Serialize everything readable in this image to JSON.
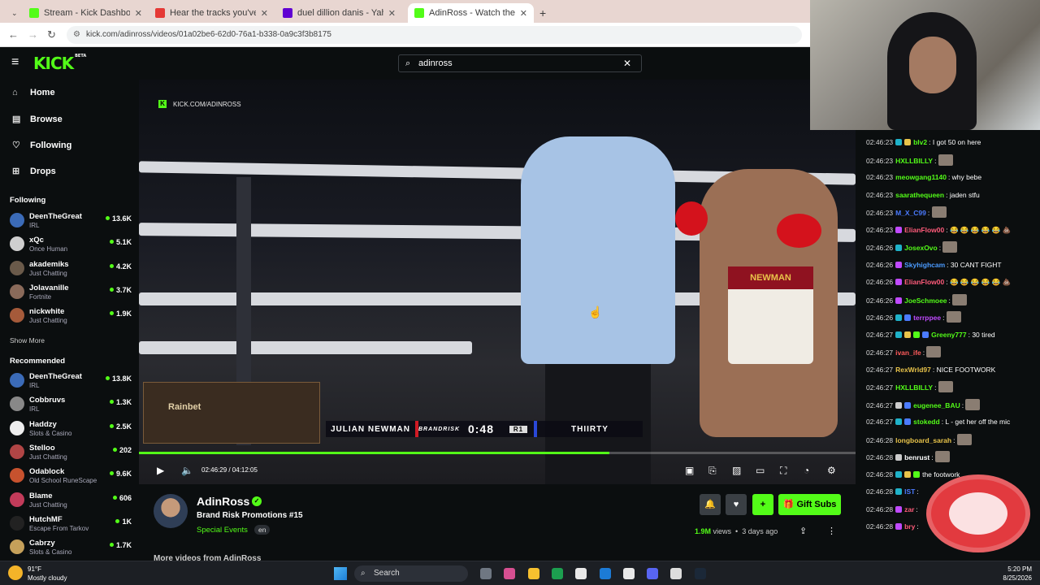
{
  "browser": {
    "tabs": [
      {
        "title": "Stream - Kick Dashboard",
        "favicon_color": "#53fc18",
        "active": false
      },
      {
        "title": "Hear the tracks you've liked: on",
        "favicon_color": "#e53935",
        "active": false
      },
      {
        "title": "duel dillion danis - Yahoo Sear",
        "favicon_color": "#6001d2",
        "active": false
      },
      {
        "title": "AdinRoss - Watch the VOD on",
        "favicon_color": "#53fc18",
        "active": true
      }
    ],
    "new_tab_label": "+",
    "url": "kick.com/adinross/videos/01a02be6-62d0-76a1-b338-0a9c3f3b8175"
  },
  "kick": {
    "logo": "KICK",
    "logo_tag": "BETA",
    "search_value": "adinross",
    "nav": [
      {
        "label": "Home",
        "icon": "home-icon",
        "glyph": "⌂"
      },
      {
        "label": "Browse",
        "icon": "browse-icon",
        "glyph": "▤"
      },
      {
        "label": "Following",
        "icon": "heart-icon",
        "glyph": "♡"
      },
      {
        "label": "Drops",
        "icon": "drops-icon",
        "glyph": "⊞"
      }
    ],
    "following_header": "Following",
    "following": [
      {
        "name": "DeenTheGreat",
        "game": "IRL",
        "viewers": "13.6K",
        "color": "#3b6bb8"
      },
      {
        "name": "xQc",
        "game": "Once Human",
        "viewers": "5.1K",
        "color": "#cfcfcf"
      },
      {
        "name": "akademiks",
        "game": "Just Chatting",
        "viewers": "4.2K",
        "color": "#6a5a4a"
      },
      {
        "name": "Jolavanille",
        "game": "Fortnite",
        "viewers": "3.7K",
        "color": "#8a6a5a"
      },
      {
        "name": "nickwhite",
        "game": "Just Chatting",
        "viewers": "1.9K",
        "color": "#a55a3a"
      }
    ],
    "show_more": "Show More",
    "recommended_header": "Recommended",
    "recommended": [
      {
        "name": "DeenTheGreat",
        "game": "IRL",
        "viewers": "13.8K",
        "color": "#3b6bb8"
      },
      {
        "name": "Cobbruvs",
        "game": "IRL",
        "viewers": "1.3K",
        "color": "#888888"
      },
      {
        "name": "Haddzy",
        "game": "Slots & Casino",
        "viewers": "2.5K",
        "color": "#eeeeee"
      },
      {
        "name": "Stelloo",
        "game": "Just Chatting",
        "viewers": "202",
        "color": "#b04545"
      },
      {
        "name": "Odablock",
        "game": "Old School RuneScape",
        "viewers": "9.6K",
        "color": "#c7522e"
      },
      {
        "name": "Blame",
        "game": "Just Chatting",
        "viewers": "606",
        "color": "#c23b5a"
      },
      {
        "name": "HutchMF",
        "game": "Escape From Tarkov",
        "viewers": "1K",
        "color": "#222222"
      },
      {
        "name": "Cabrzy",
        "game": "Slots & Casino",
        "viewers": "1.7K",
        "color": "#c5a05a"
      }
    ]
  },
  "video": {
    "watermark": "KICK.COM/ADINROSS",
    "fighter_left": "JULIAN NEWMAN",
    "sponsor": "BRANDRISK",
    "clock": "0:48",
    "round": "R1",
    "fighter_right": "THIIRTY",
    "trunks_text": "NEWMAN",
    "ad_text": "Rainbet",
    "progress_fraction": 0.657,
    "timecode": "02:46:29 / 04:12:05"
  },
  "channel": {
    "name": "AdinRoss",
    "title": "Brand Risk Promotions #15",
    "category": "Special Events",
    "language": "en",
    "views_count": "1.9M",
    "views_label": "views",
    "age": "3 days ago",
    "gift_label": "Gift Subs",
    "more_videos": "More videos from AdinRoss"
  },
  "chat": [
    {
      "time": "02:46:23",
      "user": "bIv2",
      "color": "#53fc18",
      "badges": [
        "#1fb2c9",
        "#e8c34a"
      ],
      "text": "I got 50 on here",
      "emote": false
    },
    {
      "time": "02:46:23",
      "user": "HXLLBILLY",
      "color": "#53fc18",
      "badges": [],
      "text": "",
      "emote": true
    },
    {
      "time": "02:46:23",
      "user": "meowgang1140",
      "color": "#53fc18",
      "badges": [],
      "text": "why bebe",
      "emote": false
    },
    {
      "time": "02:46:23",
      "user": "saarathequeen",
      "color": "#53fc18",
      "badges": [],
      "text": "jaden stfu",
      "emote": false
    },
    {
      "time": "02:46:23",
      "user": "M_X_C99",
      "color": "#4b7bff",
      "badges": [],
      "text": "",
      "emote": true
    },
    {
      "time": "02:46:23",
      "user": "ElianFlow00",
      "color": "#ff5b7a",
      "badges": [
        "#c04aff"
      ],
      "text": "😂 😂 😂 😂 😂 💩",
      "emote": false
    },
    {
      "time": "02:46:26",
      "user": "JosexOvo",
      "color": "#53fc18",
      "badges": [
        "#1fb2c9"
      ],
      "text": "",
      "emote": true
    },
    {
      "time": "02:46:26",
      "user": "Skyhighcam",
      "color": "#4b9bff",
      "badges": [
        "#c04aff"
      ],
      "text": "30 CANT FIGHT",
      "emote": false
    },
    {
      "time": "02:46:26",
      "user": "ElianFlow00",
      "color": "#ff5b7a",
      "badges": [
        "#c04aff"
      ],
      "text": "😂 😂 😂 😂 😂 💩",
      "emote": false
    },
    {
      "time": "02:46:26",
      "user": "JoeSchmoee",
      "color": "#53fc18",
      "badges": [
        "#c04aff"
      ],
      "text": "",
      "emote": true
    },
    {
      "time": "02:46:26",
      "user": "terrppee",
      "color": "#c04aff",
      "badges": [
        "#1fb2c9",
        "#4b7bff"
      ],
      "text": "",
      "emote": true
    },
    {
      "time": "02:46:27",
      "user": "Greeny777",
      "color": "#53fc18",
      "badges": [
        "#1fb2c9",
        "#e8c34a",
        "#53fc18",
        "#4b7bff"
      ],
      "text": "30 tired",
      "emote": false
    },
    {
      "time": "02:46:27",
      "user": "ivan_ife",
      "color": "#ff5b5b",
      "badges": [],
      "text": "",
      "emote": true
    },
    {
      "time": "02:46:27",
      "user": "RexWrld97",
      "color": "#e8c34a",
      "badges": [],
      "text": "NICE FOOTWORK",
      "emote": false
    },
    {
      "time": "02:46:27",
      "user": "HXLLBILLY",
      "color": "#53fc18",
      "badges": [],
      "text": "",
      "emote": true
    },
    {
      "time": "02:46:27",
      "user": "eugenee_BAU",
      "color": "#53fc18",
      "badges": [
        "#cccccc",
        "#4b7bff"
      ],
      "text": "",
      "emote": true
    },
    {
      "time": "02:46:27",
      "user": "stokedd",
      "color": "#53fc18",
      "badges": [
        "#1fb2c9",
        "#4b7bff"
      ],
      "text": "L - get her off the mic",
      "emote": false
    },
    {
      "time": "02:46:28",
      "user": "longboard_sarah",
      "color": "#e8c34a",
      "badges": [],
      "text": "",
      "emote": true
    },
    {
      "time": "02:46:28",
      "user": "benrust",
      "color": "#ffffff",
      "badges": [
        "#cccccc"
      ],
      "text": "",
      "emote": true
    },
    {
      "time": "02:46:28",
      "user": "",
      "color": "#53fc18",
      "badges": [
        "#1fb2c9",
        "#e8c34a",
        "#53fc18"
      ],
      "text": "the footwork",
      "emote": false
    },
    {
      "time": "02:46:28",
      "user": "IST",
      "color": "#4b7bff",
      "badges": [
        "#1fb2c9"
      ],
      "text": "",
      "emote": false
    },
    {
      "time": "02:46:28",
      "user": "zar",
      "color": "#ff5b7a",
      "badges": [
        "#c04aff"
      ],
      "text": "",
      "emote": false
    },
    {
      "time": "02:46:28",
      "user": "bry",
      "color": "#ff5b7a",
      "badges": [
        "#c04aff"
      ],
      "text": "",
      "emote": false
    }
  ],
  "taskbar": {
    "temperature": "91°F",
    "condition": "Mostly cloudy",
    "search_label": "Search",
    "time": "5:20 PM",
    "date": "8/25/2026",
    "app_colors": [
      "#6f7782",
      "#d64f91",
      "#f7c12f",
      "#1c9f4f",
      "#e8e8e8",
      "#1c7bd6",
      "#e8e8e8",
      "#5865f2",
      "#dddddd",
      "#1b2838"
    ]
  },
  "colors": {
    "accent": "#53fc18",
    "background": "#0b0e0f"
  }
}
